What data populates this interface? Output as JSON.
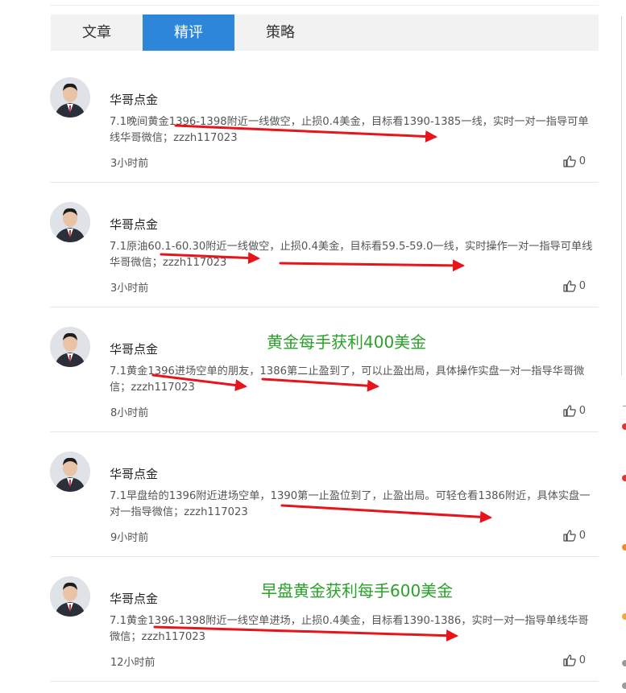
{
  "tabs": [
    {
      "label": "文章"
    },
    {
      "label": "精评"
    },
    {
      "label": "策略"
    }
  ],
  "active_tab": 1,
  "posts": [
    {
      "author": "华哥点金",
      "content": "7.1晚间黄金1396-1398附近一线做空，止损0.4美金，目标看1390-1385一线，实时一对一指导可单线华哥微信；zzzh117023",
      "time": "3小时前",
      "likes": "0"
    },
    {
      "author": "华哥点金",
      "content": "7.1原油60.1-60.30附近一线做空，止损0.4美金，目标看59.5-59.0一线，实时操作一对一指导可单线华哥微信；zzzh117023",
      "time": "3小时前",
      "likes": "0"
    },
    {
      "author": "华哥点金",
      "content": "7.1黄金1396进场空单的朋友，1386第二止盈到了，可以止盈出局，具体操作实盘一对一指导华哥微信；zzzh117023",
      "time": "8小时前",
      "likes": "0",
      "annotation": "黄金每手获利400美金"
    },
    {
      "author": "华哥点金",
      "content": "7.1早盘给的1396附近进场空单，1390第一止盈位到了，止盈出局。可轻仓看1386附近，具体实盘一对一指导微信；zzzh117023",
      "time": "9小时前",
      "likes": "0"
    },
    {
      "author": "华哥点金",
      "content": "7.1黄金1396-1398附近一线空单进场，止损0.4美金，目标看1390-1386，实时一对一指导单线华哥微信；zzzh117023",
      "time": "12小时前",
      "likes": "0",
      "annotation": "早盘黄金获利每手600美金"
    }
  ],
  "colors": {
    "tab_active": "#2d86d9",
    "annotation": "#2aa12a",
    "arrow": "#e8141b"
  },
  "icons": {
    "like": "thumbs-up-icon",
    "avatar": "avatar-photo"
  }
}
